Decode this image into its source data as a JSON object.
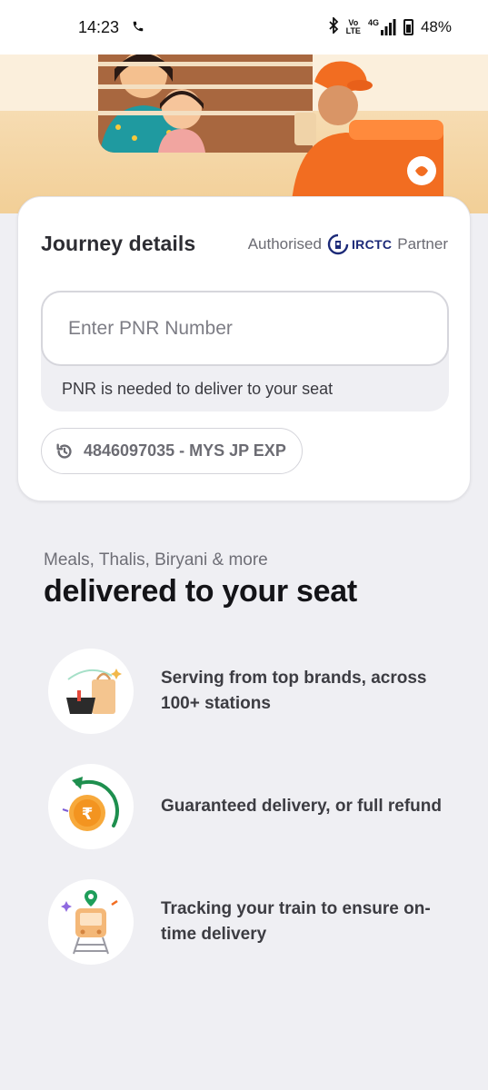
{
  "status_bar": {
    "time": "14:23",
    "network_top": "Vo",
    "network_bottom": "LTE",
    "signal_label": "4G",
    "battery": "48%"
  },
  "journey": {
    "title": "Journey details",
    "authorised_label": "Authorised",
    "partner_brand": "IRCTC",
    "partner_label": "Partner",
    "pnr_placeholder": "Enter PNR Number",
    "pnr_hint": "PNR is needed to deliver to your seat",
    "recent_pnr": "4846097035 - MYS JP EXP"
  },
  "promo": {
    "subheading": "Meals, Thalis, Biryani & more",
    "headline": "delivered to your seat",
    "features": [
      {
        "icon": "food-bag-icon",
        "text": "Serving from top brands, across 100+ stations"
      },
      {
        "icon": "refund-rupee-icon",
        "text": "Guaranteed delivery, or full refund"
      },
      {
        "icon": "train-tracking-icon",
        "text": "Tracking your train to ensure on-time delivery"
      }
    ]
  },
  "colors": {
    "accent_orange": "#f26d21",
    "background": "#efeff3",
    "irctc_blue": "#1c2a78"
  }
}
